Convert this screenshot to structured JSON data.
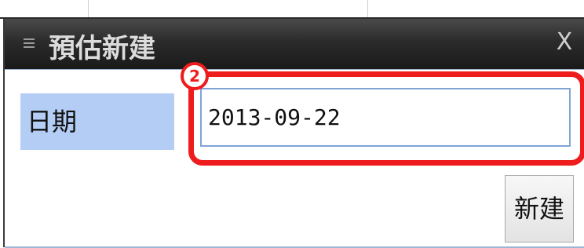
{
  "dialog": {
    "title": "預估新建",
    "menu_icon": "menu-icon",
    "close_label": "X"
  },
  "form": {
    "date_label": "日期",
    "date_value": "2013-09-22",
    "create_label": "新建"
  },
  "annotation": {
    "step": "2",
    "color": "#ee1c1c"
  }
}
